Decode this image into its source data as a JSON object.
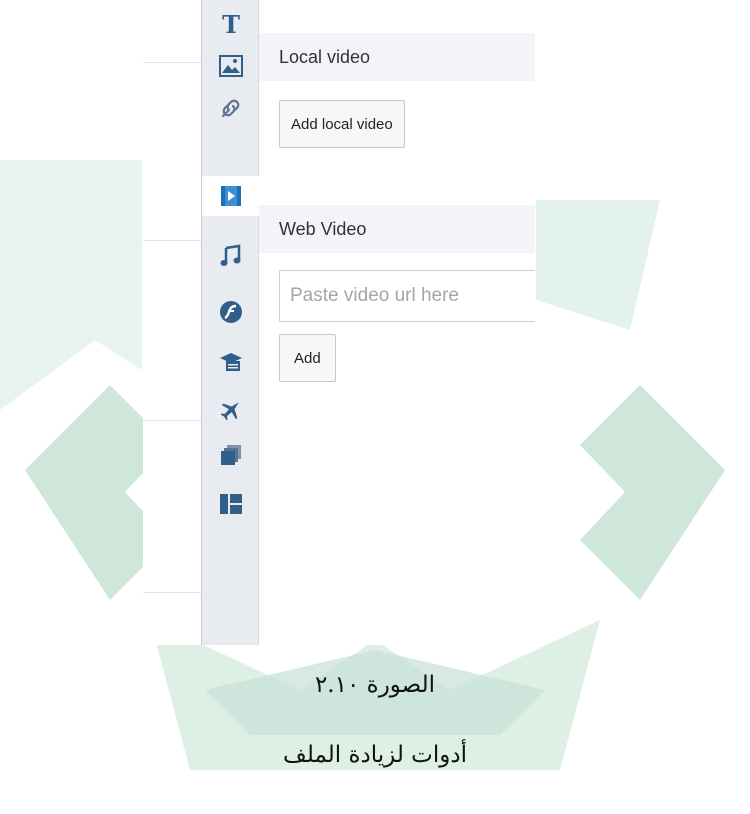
{
  "rail": {
    "items": [
      {
        "name": "text-tool",
        "icon": "text-icon"
      },
      {
        "name": "image-tool",
        "icon": "image-icon"
      },
      {
        "name": "link-tool",
        "icon": "link-icon"
      },
      {
        "name": "video-tool",
        "icon": "video-icon",
        "active": true
      },
      {
        "name": "music-tool",
        "icon": "music-icon"
      },
      {
        "name": "flash-tool",
        "icon": "flash-icon"
      },
      {
        "name": "course-tool",
        "icon": "graduation-cap-icon"
      },
      {
        "name": "flight-tool",
        "icon": "airplane-icon"
      },
      {
        "name": "gallery-tool",
        "icon": "stack-icon"
      },
      {
        "name": "layout-tool",
        "icon": "layout-icon"
      }
    ],
    "accent_color": "#2f5f8a",
    "active_color": "#3a8fd6"
  },
  "local_video": {
    "title": "Local video",
    "add_button_label": "Add local video"
  },
  "web_video": {
    "title": "Web Video",
    "url_placeholder": "Paste video url here",
    "url_value": "",
    "add_button_label": "Add"
  },
  "caption": {
    "figure_label": "الصورة ٢.١٠",
    "description": "أدوات لزيادة الملف"
  },
  "colors": {
    "watermark": "#cfe6db",
    "rail_background": "#e8ebf0",
    "section_header_background": "#f2f4f7"
  }
}
